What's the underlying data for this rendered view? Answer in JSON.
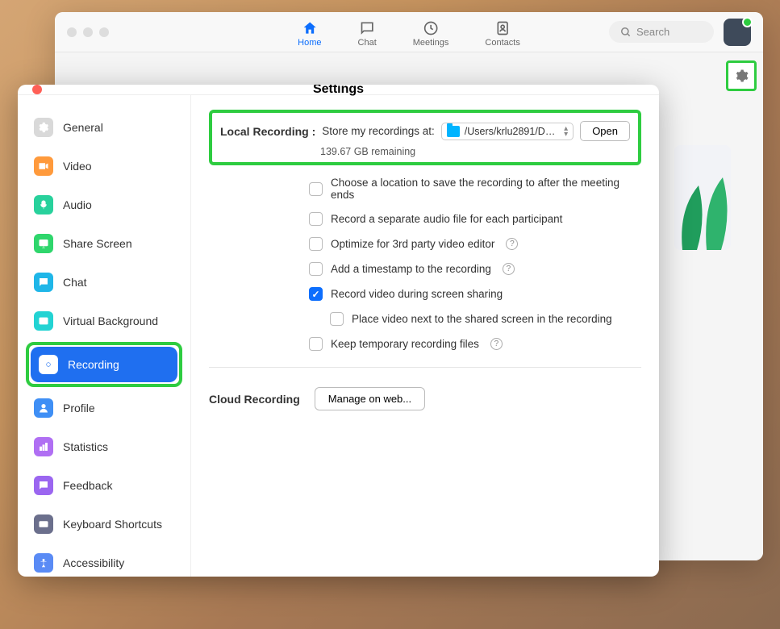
{
  "mainWindow": {
    "tabs": [
      {
        "id": "home",
        "label": "Home",
        "active": true
      },
      {
        "id": "chat",
        "label": "Chat",
        "active": false
      },
      {
        "id": "meetings",
        "label": "Meetings",
        "active": false
      },
      {
        "id": "contacts",
        "label": "Contacts",
        "active": false
      }
    ],
    "search_placeholder": "Search"
  },
  "settings": {
    "title": "Settings",
    "sidebar": [
      {
        "id": "general",
        "label": "General",
        "color": "#d9d9d9",
        "fg": "#fff"
      },
      {
        "id": "video",
        "label": "Video",
        "color": "#ff9a3c",
        "fg": "#fff"
      },
      {
        "id": "audio",
        "label": "Audio",
        "color": "#28d19c",
        "fg": "#fff"
      },
      {
        "id": "share-screen",
        "label": "Share Screen",
        "color": "#2fd66c",
        "fg": "#fff"
      },
      {
        "id": "chat",
        "label": "Chat",
        "color": "#1fb6e8",
        "fg": "#fff"
      },
      {
        "id": "virtual-background",
        "label": "Virtual Background",
        "color": "#23d3d3",
        "fg": "#fff"
      },
      {
        "id": "recording",
        "label": "Recording",
        "color": "#ffffff",
        "fg": "#1f6ff0",
        "active": true,
        "highlighted": true
      },
      {
        "id": "profile",
        "label": "Profile",
        "color": "#3f8ff5",
        "fg": "#fff"
      },
      {
        "id": "statistics",
        "label": "Statistics",
        "color": "#b06ff3",
        "fg": "#fff"
      },
      {
        "id": "feedback",
        "label": "Feedback",
        "color": "#9b66f0",
        "fg": "#fff"
      },
      {
        "id": "keyboard-shortcuts",
        "label": "Keyboard Shortcuts",
        "color": "#6b6f8c",
        "fg": "#fff"
      },
      {
        "id": "accessibility",
        "label": "Accessibility",
        "color": "#5a8bf5",
        "fg": "#fff"
      }
    ],
    "recording": {
      "local_label": "Local Recording :",
      "store_label": "Store my recordings at:",
      "path": "/Users/krlu2891/Docum…",
      "open_button": "Open",
      "remaining": "139.67 GB remaining",
      "options": [
        {
          "id": "choose-location",
          "label": "Choose a location to save the recording to after the meeting ends",
          "checked": false,
          "help": false
        },
        {
          "id": "separate-audio",
          "label": "Record a separate audio file for each participant",
          "checked": false,
          "help": false
        },
        {
          "id": "optimize-3rd",
          "label": "Optimize for 3rd party video editor",
          "checked": false,
          "help": true
        },
        {
          "id": "timestamp",
          "label": "Add a timestamp to the recording",
          "checked": false,
          "help": true
        },
        {
          "id": "record-video-share",
          "label": "Record video during screen sharing",
          "checked": true,
          "help": false
        },
        {
          "id": "place-video-next",
          "label": "Place video next to the shared screen in the recording",
          "checked": false,
          "help": false,
          "nested": true
        },
        {
          "id": "keep-temp",
          "label": "Keep temporary recording files",
          "checked": false,
          "help": true
        }
      ],
      "cloud_label": "Cloud Recording",
      "manage_button": "Manage on web..."
    }
  }
}
